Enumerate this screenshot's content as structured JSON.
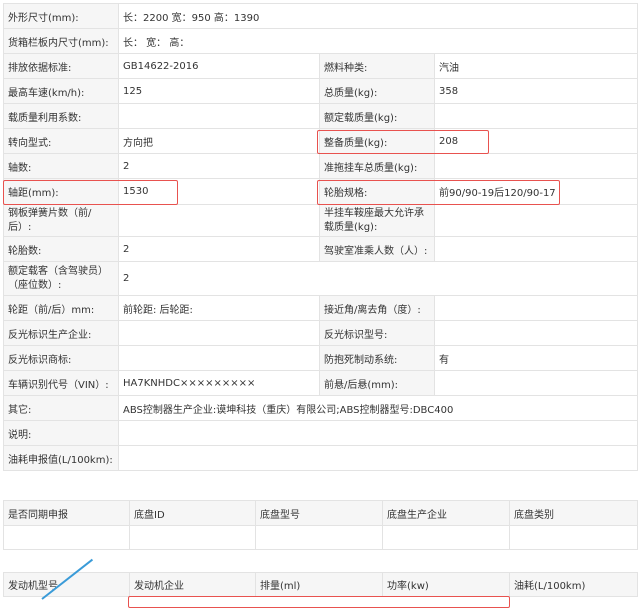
{
  "spec": {
    "outer_dim_label": "外形尺寸(mm):",
    "outer_dim_value": "长：2200 宽：950 高：1390",
    "cargo_dim_label": "货箱栏板内尺寸(mm):",
    "cargo_dim_value": "长： 宽： 高：",
    "emission_std_label": "排放依据标准:",
    "emission_std_value": "GB14622-2016",
    "fuel_type_label": "燃料种类:",
    "fuel_type_value": "汽油",
    "max_speed_label": "最高车速(km/h):",
    "max_speed_value": "125",
    "total_mass_label": "总质量(kg):",
    "total_mass_value": "358",
    "load_factor_label": "载质量利用系数:",
    "load_factor_value": "",
    "rated_load_label": "额定载质量(kg):",
    "rated_load_value": "",
    "steering_label": "转向型式:",
    "steering_value": "方向把",
    "curb_mass_label": "整备质量(kg):",
    "curb_mass_value": "208",
    "axles_label": "轴数:",
    "axles_value": "2",
    "trailer_mass_label": "准拖挂车总质量(kg):",
    "trailer_mass_value": "",
    "wheelbase_label": "轴距(mm):",
    "wheelbase_value": "1530",
    "tire_spec_label": "轮胎规格:",
    "tire_spec_value": "前90/90-19后120/90-17",
    "leaf_spring_label": "钢板弹簧片数（前/后）:",
    "leaf_spring_value": "",
    "saddle_load_label": "半挂车鞍座最大允许承载质量(kg):",
    "saddle_load_value": "",
    "tire_count_label": "轮胎数:",
    "tire_count_value": "2",
    "cab_passengers_label": "驾驶室准乘人数（人）:",
    "cab_passengers_value": "",
    "rated_passengers_label": "额定载客（含驾驶员）（座位数）:",
    "rated_passengers_value": "2",
    "track_label": "轮距（前/后）mm:",
    "track_value": "前轮距: 后轮距:",
    "approach_angle_label": "接近角/离去角（度）:",
    "approach_angle_value": "",
    "reflector_mfr_label": "反光标识生产企业:",
    "reflector_mfr_value": "",
    "reflector_model_label": "反光标识型号:",
    "reflector_model_value": "",
    "reflector_brand_label": "反光标识商标:",
    "reflector_brand_value": "",
    "abs_label": "防抱死制动系统:",
    "abs_value": "有",
    "vin_label": "车辆识别代号（VIN）:",
    "vin_value": "HA7KNHDC×××××××××",
    "overhang_label": "前悬/后悬(mm):",
    "overhang_value": "",
    "other_label": "其它:",
    "other_value": "ABS控制器生产企业:谟坤科技（重庆）有限公司;ABS控制器型号:DBC400",
    "note_label": "说明:",
    "note_value": "",
    "fuel_report_label": "油耗申报值(L/100km):",
    "fuel_report_value": ""
  },
  "chassis_table": {
    "headers": [
      "是否同期申报",
      "底盘ID",
      "底盘型号",
      "底盘生产企业",
      "底盘类别"
    ]
  },
  "engine_table": {
    "headers": [
      "发动机型号",
      "发动机企业",
      "排量(ml)",
      "功率(kw)",
      "油耗(L/100km)"
    ]
  },
  "colors": {
    "highlight": "#e8524f",
    "label_bg": "#f6f6f6",
    "border": "#e3e3e3"
  }
}
